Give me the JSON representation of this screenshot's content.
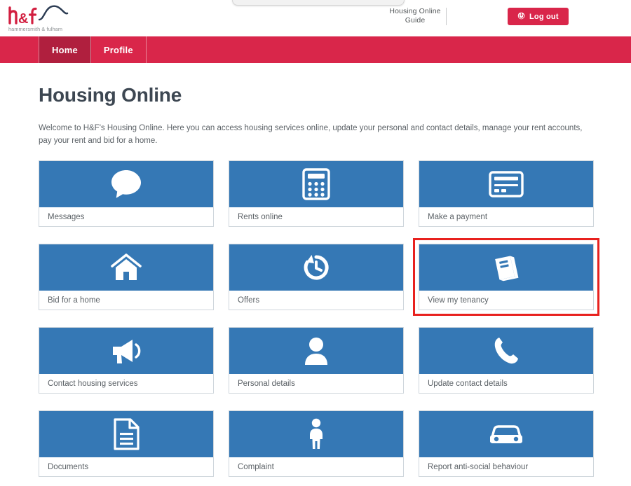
{
  "header": {
    "logo": {
      "mark": "h&f",
      "subtitle": "hammersmith & fulham",
      "icon_name": "hf-logo"
    },
    "guide_link": "Housing Online\nGuide",
    "guide_link_line1": "Housing Online",
    "guide_link_line2": "Guide",
    "logout_label": "Log out",
    "logout_icon": "sign-out-icon"
  },
  "nav": {
    "items": [
      {
        "label": "Home",
        "active": true
      },
      {
        "label": "Profile",
        "active": false
      }
    ]
  },
  "main": {
    "title": "Housing Online",
    "welcome": "Welcome to H&F's Housing Online. Here you can access housing services online, update your personal and contact details, manage your rent accounts, pay your rent and bid for a home."
  },
  "colors": {
    "brand_red": "#d9264a",
    "nav_active_red": "#b01f3e",
    "tile_blue": "#3578b5",
    "highlight_red": "#e8211e",
    "title_grey": "#3d4752",
    "body_grey": "#5c6267"
  },
  "tiles": [
    {
      "label": "Messages",
      "icon": "speech-bubble-icon",
      "highlighted": false
    },
    {
      "label": "Rents online",
      "icon": "calculator-icon",
      "highlighted": false
    },
    {
      "label": "Make a payment",
      "icon": "credit-card-icon",
      "highlighted": false
    },
    {
      "label": "Bid for a home",
      "icon": "house-icon",
      "highlighted": false
    },
    {
      "label": "Offers",
      "icon": "history-clock-icon",
      "highlighted": false
    },
    {
      "label": "View my tenancy",
      "icon": "book-icon",
      "highlighted": true
    },
    {
      "label": "Contact housing services",
      "icon": "megaphone-icon",
      "highlighted": false
    },
    {
      "label": "Personal details",
      "icon": "person-icon",
      "highlighted": false
    },
    {
      "label": "Update contact details",
      "icon": "phone-icon",
      "highlighted": false
    },
    {
      "label": "Documents",
      "icon": "document-icon",
      "highlighted": false
    },
    {
      "label": "Complaint",
      "icon": "standing-person-icon",
      "highlighted": false
    },
    {
      "label": "Report anti-social behaviour",
      "icon": "car-icon",
      "highlighted": false
    }
  ]
}
